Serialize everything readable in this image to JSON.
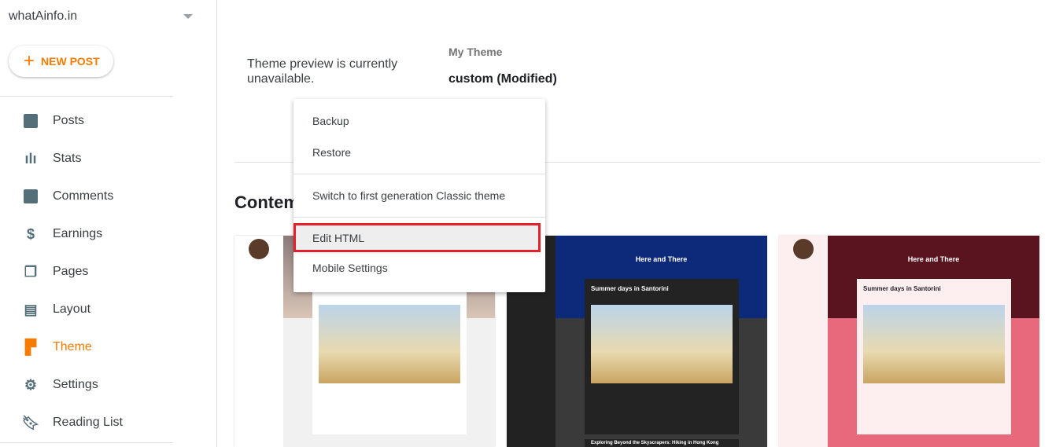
{
  "sidebar": {
    "blog_name": "whatAinfo.in",
    "new_post": "NEW POST",
    "items": [
      {
        "label": "Posts",
        "icon": "posts-icon"
      },
      {
        "label": "Stats",
        "icon": "stats-icon"
      },
      {
        "label": "Comments",
        "icon": "comment-icon"
      },
      {
        "label": "Earnings",
        "icon": "dollar-icon"
      },
      {
        "label": "Pages",
        "icon": "pages-icon"
      },
      {
        "label": "Layout",
        "icon": "layout-icon"
      },
      {
        "label": "Theme",
        "icon": "paint-roller-icon",
        "active": true
      },
      {
        "label": "Settings",
        "icon": "gear-icon"
      },
      {
        "label": "Reading List",
        "icon": "bookmark-icon"
      }
    ]
  },
  "main": {
    "preview_unavailable": "Theme preview is currently unavailable.",
    "my_theme_label": "My Theme",
    "theme_name": "custom (Modified)",
    "section_title": "Contemporary"
  },
  "menu": {
    "items": [
      "Backup",
      "Restore",
      "Switch to first generation Classic theme",
      "Edit HTML",
      "Mobile Settings"
    ],
    "highlighted": "Edit HTML"
  },
  "thumbnails": {
    "blog_title": "Here and There",
    "post_title": "Summer days in Santorini",
    "post2_title": "Exploring Beyond the Skyscrapers: Hiking in Hong Kong"
  },
  "colors": {
    "accent": "#f57c00",
    "highlight_border": "#e4202a"
  }
}
